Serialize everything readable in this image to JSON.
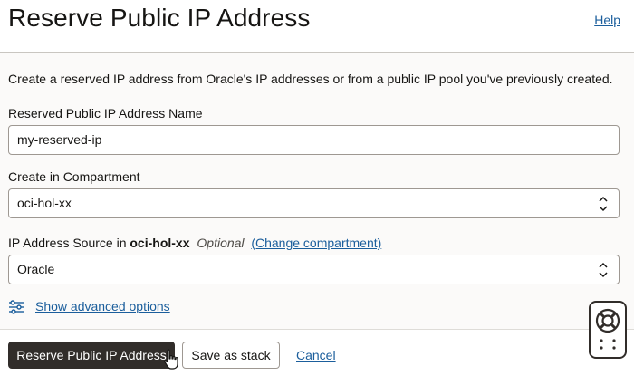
{
  "header": {
    "title": "Reserve Public IP Address",
    "help_label": "Help"
  },
  "description": "Create a reserved IP address from Oracle's IP addresses or from a public IP pool you've previously created.",
  "fields": {
    "name": {
      "label": "Reserved Public IP Address Name",
      "value": "my-reserved-ip"
    },
    "compartment": {
      "label": "Create in Compartment",
      "value": "oci-hol-xx"
    },
    "source": {
      "label_prefix": "IP Address Source in",
      "compartment_name": "oci-hol-xx",
      "optional": "Optional",
      "change_link": "(Change compartment)",
      "value": "Oracle"
    }
  },
  "advanced": {
    "label": "Show advanced options",
    "icon": "sliders-icon"
  },
  "footer": {
    "primary_label": "Reserve Public IP Address",
    "stack_label": "Save as stack",
    "cancel_label": "Cancel"
  },
  "colors": {
    "link": "#1b5e9c",
    "primary_button": "#312d2a",
    "panel_bg": "#fbfaf9"
  }
}
